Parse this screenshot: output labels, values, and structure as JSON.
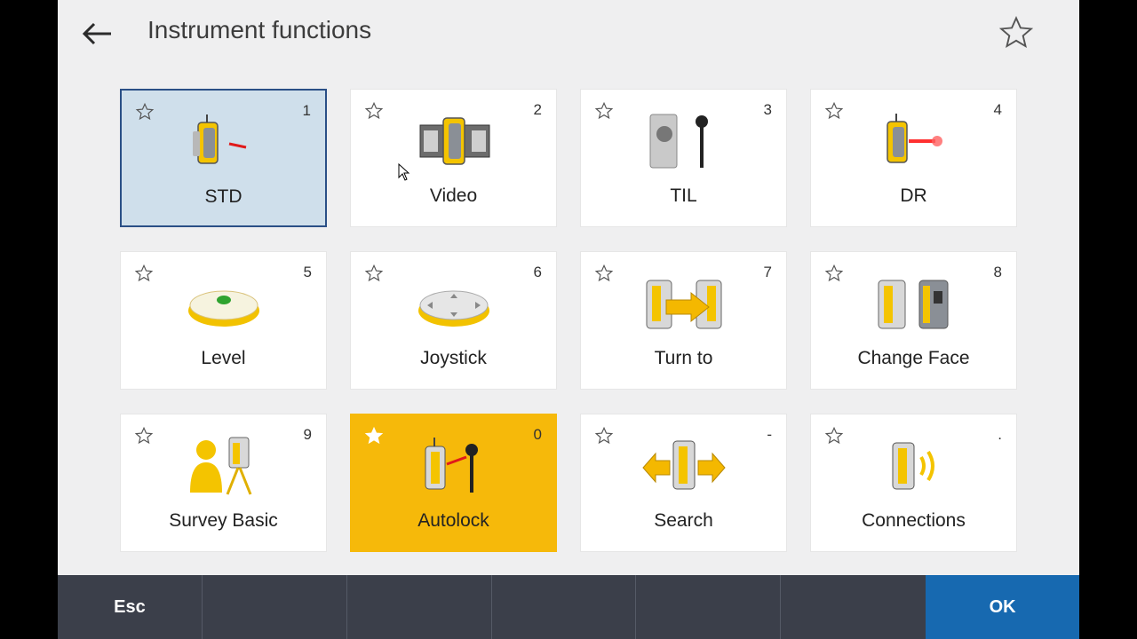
{
  "header": {
    "title": "Instrument functions",
    "back_icon": "arrow-left-icon",
    "favorite_icon": "star-outline-icon"
  },
  "colors": {
    "selected_bg": "#cfdfeb",
    "selected_border": "#2a4f86",
    "active_bg": "#f6b90a",
    "bottom_bar": "#3b3f4a",
    "ok_button": "#1769b0"
  },
  "tiles": [
    {
      "label": "STD",
      "key": "1",
      "icon": "std-mode-icon",
      "state": "selected"
    },
    {
      "label": "Video",
      "key": "2",
      "icon": "video-icon",
      "state": "normal"
    },
    {
      "label": "TIL",
      "key": "3",
      "icon": "til-icon",
      "state": "normal"
    },
    {
      "label": "DR",
      "key": "4",
      "icon": "dr-mode-icon",
      "state": "normal"
    },
    {
      "label": "Level",
      "key": "5",
      "icon": "level-icon",
      "state": "normal"
    },
    {
      "label": "Joystick",
      "key": "6",
      "icon": "joystick-icon",
      "state": "normal"
    },
    {
      "label": "Turn to",
      "key": "7",
      "icon": "turn-to-icon",
      "state": "normal"
    },
    {
      "label": "Change Face",
      "key": "8",
      "icon": "change-face-icon",
      "state": "normal"
    },
    {
      "label": "Survey Basic",
      "key": "9",
      "icon": "survey-basic-icon",
      "state": "normal"
    },
    {
      "label": "Autolock",
      "key": "0",
      "icon": "autolock-icon",
      "state": "active"
    },
    {
      "label": "Search",
      "key": "-",
      "icon": "search-prism-icon",
      "state": "normal"
    },
    {
      "label": "Connections",
      "key": ".",
      "icon": "connections-icon",
      "state": "normal"
    }
  ],
  "softkeys": {
    "esc": "Esc",
    "ok": "OK"
  }
}
